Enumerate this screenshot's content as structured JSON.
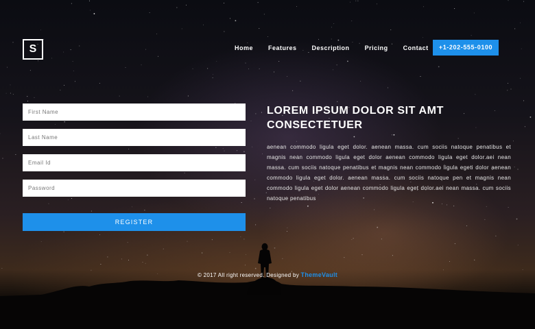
{
  "header": {
    "logo_letter": "S",
    "nav": [
      "Home",
      "Features",
      "Description",
      "Pricing",
      "Contact"
    ],
    "phone": "+1-202-555-0100"
  },
  "form": {
    "first_name_placeholder": "First Name",
    "last_name_placeholder": "Last Name",
    "email_placeholder": "Email Id",
    "password_placeholder": "Password",
    "register_label": "REGISTER"
  },
  "content": {
    "heading": "LOREM IPSUM DOLOR SIT AMT CONSECTETUER",
    "body": "aenean commodo ligula eget dolor. aenean massa. cum sociis natoque penatibus et magnis nean commodo ligula eget dolor aenean commodo ligula eget dolor.aei nean massa. cum sociis natoque penatibus et magnis nean commodo ligula egeti dolor aenean commodo ligula eget dolor. aenean massa. cum sociis natoque pen et magnis nean commodo ligula eget dolor aenean commodo ligula eget dolor.aei nean massa. cum sociis natoque penatibus"
  },
  "footer": {
    "copyright": "© 2017 All right reserved. Designed by",
    "brand": "ThemeVault"
  },
  "colors": {
    "accent": "#1e90ea",
    "text": "#ffffff"
  }
}
